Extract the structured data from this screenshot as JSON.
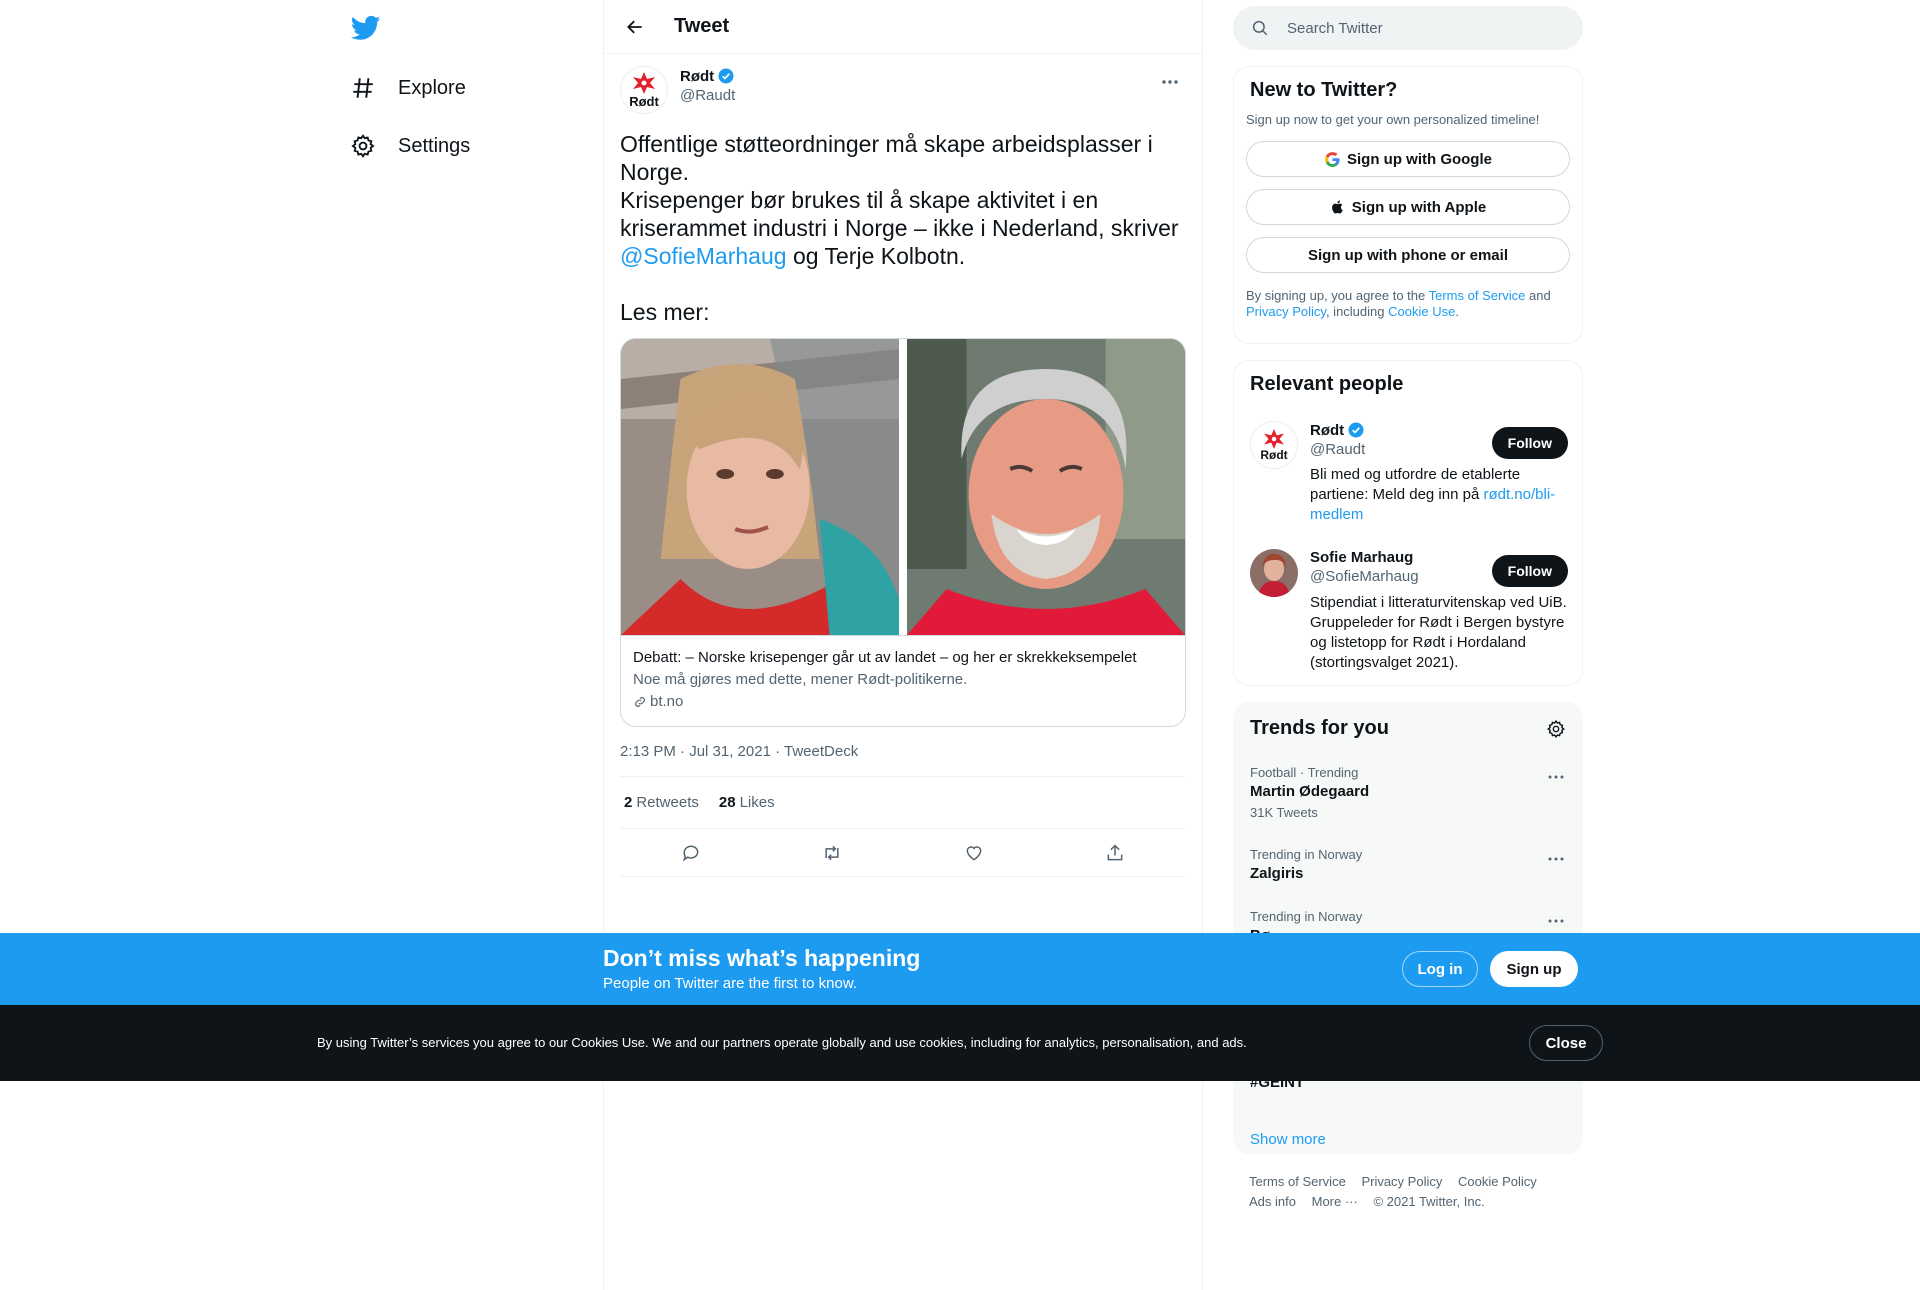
{
  "nav": {
    "items": [
      {
        "label": "Explore",
        "icon": "hashtag-icon"
      },
      {
        "label": "Settings",
        "icon": "gear-icon"
      }
    ]
  },
  "header": {
    "title": "Tweet"
  },
  "tweet": {
    "author_name": "Rødt",
    "author_handle": "@Raudt",
    "text_part1": "Offentlige støtteordninger må skape arbeidsplasser i Norge.\nKrisepenger bør brukes til å skape aktivitet i en kriserammet industri i Norge – ikke i Nederland, skriver ",
    "mention": "@SofieMarhaug",
    "text_part2": " og Terje Kolbotn.\n\nLes mer:",
    "card": {
      "title": "Debatt: – Norske krisepenger går ut av landet – og her er skrekkeksempelet",
      "description": "Noe må gjøres med dette, mener Rødt-politikerne.",
      "domain": "bt.no"
    },
    "time": "2:13 PM · Jul 31, 2021",
    "source": "TweetDeck",
    "retweets": "2",
    "retweets_label": "Retweets",
    "likes": "28",
    "likes_label": "Likes",
    "avatar_text": "Rødt"
  },
  "search": {
    "placeholder": "Search Twitter"
  },
  "signup_panel": {
    "title": "New to Twitter?",
    "subtitle": "Sign up now to get your own personalized timeline!",
    "google_label": "Sign up with Google",
    "apple_label": "Sign up with Apple",
    "phone_label": "Sign up with phone or email",
    "legal_1": "By signing up, you agree to the ",
    "terms": "Terms of Service",
    "legal_2": " and ",
    "privacy": "Privacy Policy",
    "legal_3": ", including ",
    "cookie": "Cookie Use",
    "legal_4": "."
  },
  "relevant": {
    "title": "Relevant people",
    "follow_label": "Follow",
    "people": [
      {
        "name": "Rødt",
        "handle": "@Raudt",
        "bio": "Bli med og utfordre de etablerte partiene: Meld deg inn på ",
        "bio_link": "rødt.no/bli-medlem"
      },
      {
        "name": "Sofie Marhaug",
        "handle": "@SofieMarhaug",
        "bio": "Stipendiat i litteraturvitenskap ved UiB. Gruppeleder for Rødt i Bergen bystyre og listetopp for Rødt i Hordaland (stortingsvalget 2021)."
      }
    ]
  },
  "trends": {
    "title": "Trends for you",
    "items": [
      {
        "context": "Football · Trending",
        "name": "Martin Ødegaard",
        "count": "31K Tweets"
      },
      {
        "context": "Trending in Norway",
        "name": "Zalgiris",
        "count": ""
      },
      {
        "context": "Trending in Norway",
        "name": "Bø...",
        "count": ""
      }
    ],
    "hidden_name": "#GEINT",
    "show_more": "Show more"
  },
  "footer": {
    "links": [
      "Terms of Service",
      "Privacy Policy",
      "Cookie Policy",
      "Ads info",
      "More ···",
      "© 2021 Twitter, Inc."
    ]
  },
  "banner": {
    "title": "Don’t miss what’s happening",
    "subtitle": "People on Twitter are the first to know.",
    "login": "Log in",
    "signup": "Sign up"
  },
  "cookie_banner": {
    "text": "By using Twitter’s services you agree to our Cookies Use. We and our partners operate globally and use cookies, including for analytics, personalisation, and ads.",
    "close": "Close"
  },
  "colors": {
    "accent": "#1d9bf0",
    "dark": "#0f1419",
    "muted": "#536471",
    "rodt_red": "#e4202c"
  }
}
